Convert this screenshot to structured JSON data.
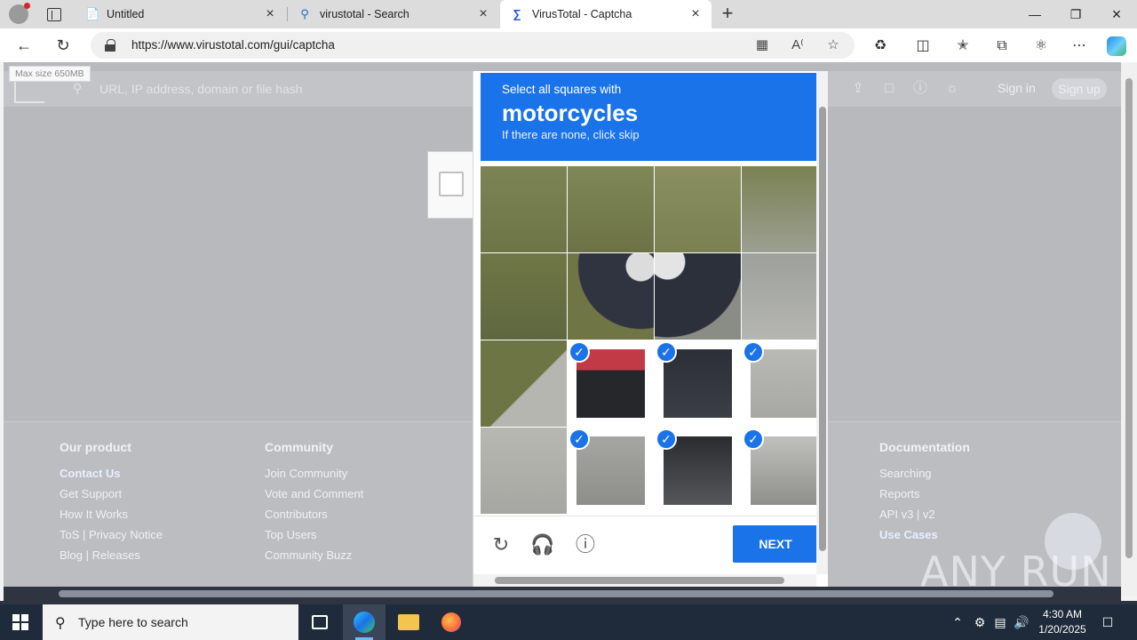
{
  "browser": {
    "tabs": [
      {
        "title": "Untitled",
        "icon": "document-icon",
        "active": false
      },
      {
        "title": "virustotal - Search",
        "icon": "search-icon",
        "active": false
      },
      {
        "title": "VirusTotal - Captcha",
        "icon": "virustotal-icon",
        "active": true
      }
    ],
    "url": "https://www.virustotal.com/gui/captcha"
  },
  "page": {
    "search_placeholder": "URL, IP address, domain or file hash",
    "max_size": "Max size 650MB",
    "sign_in": "Sign in",
    "sign_up": "Sign up",
    "footer": {
      "col1": {
        "heading": "Our product",
        "links": [
          "Contact Us",
          "Get Support",
          "How It Works",
          "ToS | Privacy Notice",
          "Blog | Releases"
        ]
      },
      "col2": {
        "heading": "Community",
        "links": [
          "Join Community",
          "Vote and Comment",
          "Contributors",
          "Top Users",
          "Community Buzz"
        ]
      },
      "col5": {
        "heading": "Documentation",
        "links": [
          "Searching",
          "Reports",
          "API v3 | v2",
          "Use Cases"
        ]
      }
    },
    "watermark": "ANY RUN"
  },
  "captcha": {
    "prompt": "Select all squares with",
    "target": "motorcycles",
    "hint": "If there are none, click skip",
    "tiles_selected": [
      9,
      10,
      11,
      13,
      14,
      15
    ],
    "next_label": "NEXT",
    "colors": {
      "accent": "#1a73e8"
    }
  },
  "taskbar": {
    "search_text": "Type here to search",
    "time": "4:30 AM",
    "date": "1/20/2025"
  }
}
